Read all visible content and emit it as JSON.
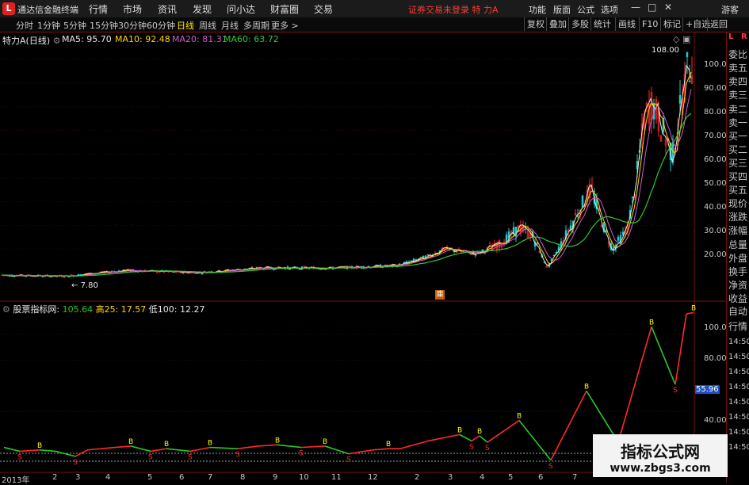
{
  "app": {
    "logo": "L",
    "title": "通达信金融终端",
    "login_status": "证券交易未登录  特 力A"
  },
  "menu": [
    "行情",
    "市场",
    "资讯",
    "发现",
    "问小达",
    "财富圈",
    "交易"
  ],
  "right_menu": [
    "功能",
    "版面",
    "公式",
    "选项"
  ],
  "window_buttons": [
    "—",
    "□",
    "✕"
  ],
  "guest": "游客",
  "periods": [
    "分时",
    "1分钟",
    "5分钟",
    "15分钟",
    "30分钟",
    "60分钟",
    "日线",
    "周线",
    "月线",
    "多周期",
    "更多 >"
  ],
  "active_period": "日线",
  "toolbar_right": [
    "复权",
    "叠加",
    "多股",
    "统计",
    "画线",
    "F10",
    "标记",
    "+自选",
    "返回"
  ],
  "stock": {
    "name": "特力A",
    "period": "(日线)"
  },
  "ma": [
    {
      "label": "MA5: 95.70",
      "color": "#e8e8e8"
    },
    {
      "label": "MA10: 92.48",
      "color": "#ffd700"
    },
    {
      "label": "MA20: 81.31",
      "color": "#d25ad2"
    },
    {
      "label": "MA60: 63.72",
      "color": "#32c832"
    }
  ],
  "price_axis": [
    "100.0",
    "90.00",
    "80.00",
    "70.00",
    "60.00",
    "50.00",
    "40.00",
    "30.00",
    "20.00"
  ],
  "high_label": "108.00",
  "low_label": "7.80",
  "event_marker": "庫",
  "indicator": {
    "name": "股票指标网",
    "value": "105.64",
    "high_label": "高25: 17.57",
    "low_label": "低100: 12.27"
  },
  "indicator_axis": [
    "100.0",
    "80.00",
    "55.96",
    "40.00"
  ],
  "indicator_current": "55.96",
  "right_panel_top": [
    "L",
    "R",
    "委比",
    "卖五",
    "卖四",
    "卖三",
    "卖二",
    "卖一",
    "买一",
    "买二",
    "买三",
    "买四",
    "买五",
    "现价",
    "涨跌",
    "涨幅",
    "总量",
    "外盘",
    "换手",
    "净资",
    "收益"
  ],
  "right_panel_bottom": [
    "自动",
    "行情",
    "14:50",
    "14:50",
    "14:50",
    "14:50",
    "14:50",
    "14:50",
    "14:50",
    "14:50"
  ],
  "x_labels": [
    "2013年",
    "2",
    "3",
    "4",
    "5",
    "6",
    "7",
    "8",
    "9",
    "10",
    "11",
    "12",
    "2",
    "3",
    "4",
    "5",
    "6",
    "7",
    "8"
  ],
  "watermark": {
    "title": "指标公式网",
    "url": "www.zbgs3.com"
  },
  "colors": {
    "up": "#ff2a2a",
    "down": "#28c828",
    "signal_b": "#ffff00",
    "frame": "#7a1010"
  }
}
